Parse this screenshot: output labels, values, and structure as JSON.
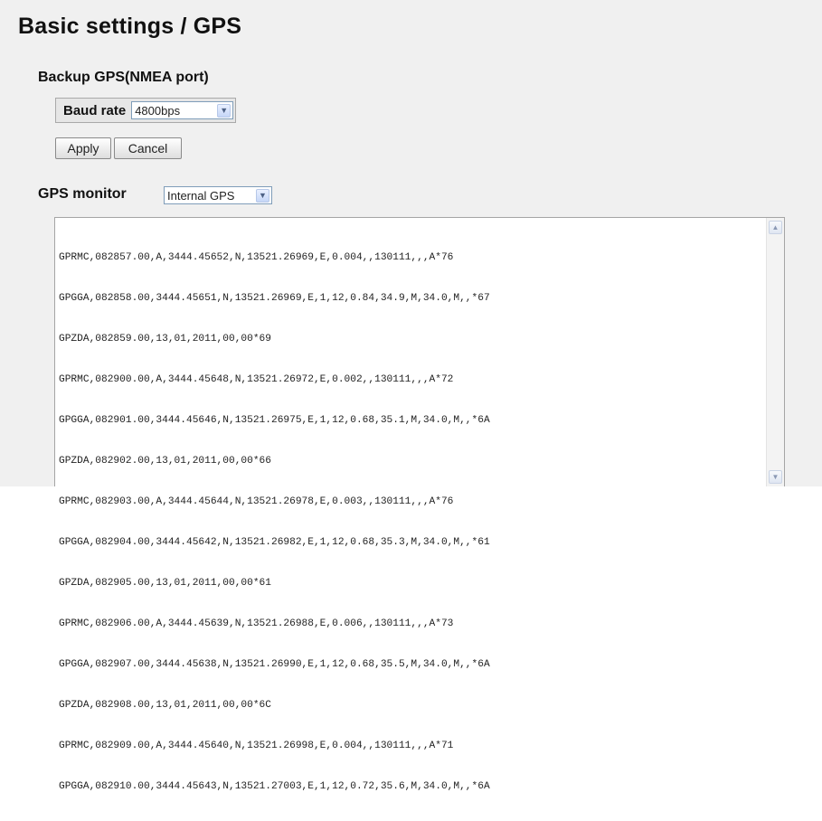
{
  "page": {
    "title": "Basic settings / GPS"
  },
  "backup": {
    "title": "Backup GPS(NMEA port)",
    "baud_label": "Baud rate",
    "baud_value": "4800bps"
  },
  "buttons": {
    "apply": "Apply",
    "cancel": "Cancel"
  },
  "monitor": {
    "label": "GPS monitor",
    "source": "Internal GPS",
    "lines": [
      "GPRMC,082857.00,A,3444.45652,N,13521.26969,E,0.004,,130111,,,A*76",
      "GPGGA,082858.00,3444.45651,N,13521.26969,E,1,12,0.84,34.9,M,34.0,M,,*67",
      "GPZDA,082859.00,13,01,2011,00,00*69",
      "GPRMC,082900.00,A,3444.45648,N,13521.26972,E,0.002,,130111,,,A*72",
      "GPGGA,082901.00,3444.45646,N,13521.26975,E,1,12,0.68,35.1,M,34.0,M,,*6A",
      "GPZDA,082902.00,13,01,2011,00,00*66",
      "GPRMC,082903.00,A,3444.45644,N,13521.26978,E,0.003,,130111,,,A*76",
      "GPGGA,082904.00,3444.45642,N,13521.26982,E,1,12,0.68,35.3,M,34.0,M,,*61",
      "GPZDA,082905.00,13,01,2011,00,00*61",
      "GPRMC,082906.00,A,3444.45639,N,13521.26988,E,0.006,,130111,,,A*73",
      "GPGGA,082907.00,3444.45638,N,13521.26990,E,1,12,0.68,35.5,M,34.0,M,,*6A",
      "GPZDA,082908.00,13,01,2011,00,00*6C",
      "GPRMC,082909.00,A,3444.45640,N,13521.26998,E,0.004,,130111,,,A*71",
      "GPGGA,082910.00,3444.45643,N,13521.27003,E,1,12,0.72,35.6,M,34.0,M,,*6A"
    ]
  },
  "icons": {
    "dropdown": "chevron-down-icon",
    "scroll_up": "scroll-up-arrow-icon",
    "scroll_down": "scroll-down-arrow-icon"
  },
  "colors": {
    "page_background": "#f0f0f0",
    "console_background": "#ffffff",
    "select_border": "#7f9db9"
  }
}
